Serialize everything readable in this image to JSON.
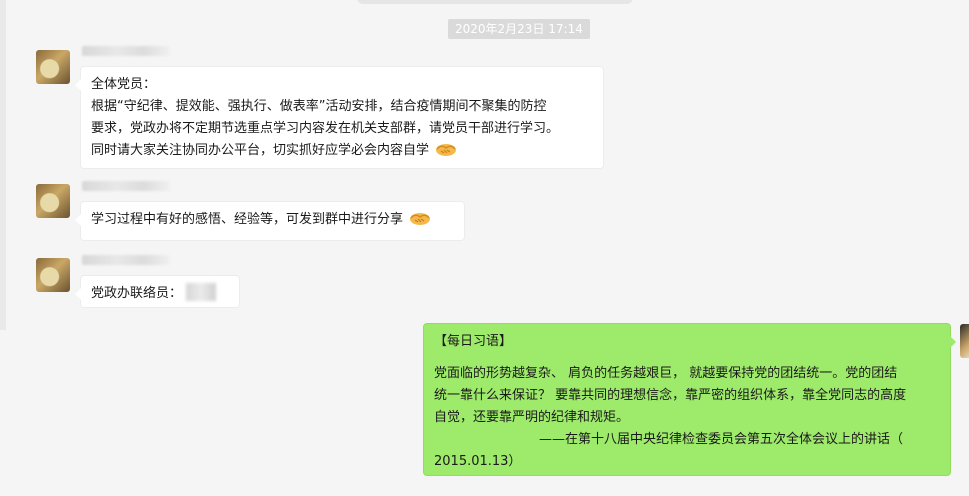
{
  "chat": {
    "timestamp": "2020年2月23日 17:14",
    "messages": [
      {
        "lines": [
          "全体党员：",
          "根据“守纪律、提效能、强执行、做表率”活动安排，结合疫情期间不聚集的防控",
          "要求，党政办将不定期节选重点学习内容发在机关支部群，请党员干部进行学习。",
          "同时请大家关注协同办公平台，切实抓好应学必会内容自学"
        ],
        "emoji": "handshake-icon"
      },
      {
        "lines": [
          "学习过程中有好的感悟、经验等，可发到群中进行分享"
        ],
        "emoji": "handshake-icon"
      },
      {
        "lines": [
          "党政办联络员："
        ]
      }
    ],
    "mine": {
      "heading": "【每日习语】",
      "lines": [
        "党面临的形势越复杂、 肩负的任务越艰巨， 就越要保持党的团结统一。党的团结",
        "统一靠什么来保证？ 要靠共同的理想信念，靠严密的组织体系，靠全党同志的高度",
        "自觉，还要靠严明的纪律和规矩。"
      ],
      "author_line": "——在第十八届中央纪律检查委员会第五次全体会议上的讲话（",
      "date_line": "2015.01.13）"
    }
  },
  "colors": {
    "background": "#f5f5f5",
    "incoming_bubble": "#ffffff",
    "outgoing_bubble": "#9eea6a",
    "timestamp_bg": "#dadada"
  }
}
